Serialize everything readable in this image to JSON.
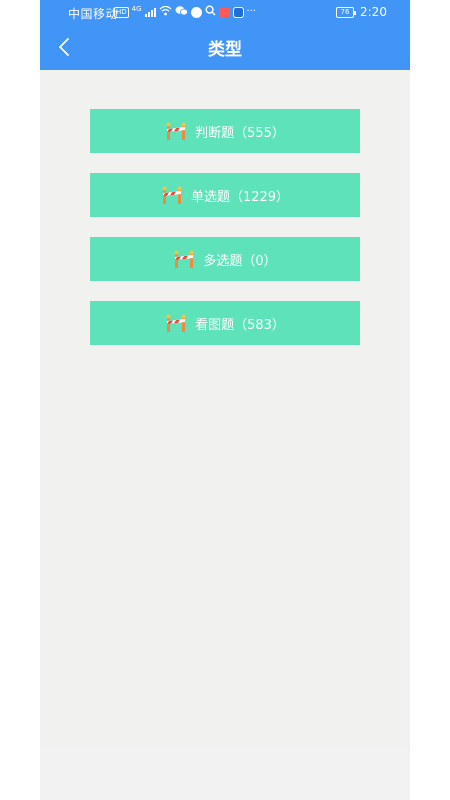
{
  "status_bar": {
    "carrier": "中国移动",
    "hd_badge": "HD",
    "network": "4G",
    "battery": "76",
    "time": "2:20"
  },
  "header": {
    "title": "类型",
    "back_icon": "chevron-left-icon"
  },
  "types": [
    {
      "label": "判断题（555）",
      "icon": "roadblock-icon"
    },
    {
      "label": "单选题（1229）",
      "icon": "roadblock-icon"
    },
    {
      "label": "多选题（0）",
      "icon": "roadblock-icon"
    },
    {
      "label": "看图题（583）",
      "icon": "roadblock-icon"
    }
  ],
  "colors": {
    "header": "#4195f6",
    "button": "#5de2ba",
    "background": "#f1f1ef"
  }
}
